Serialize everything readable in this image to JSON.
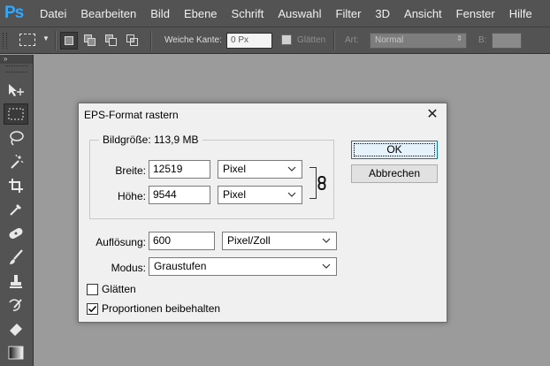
{
  "app": {
    "logo": "Ps"
  },
  "menubar": {
    "items": [
      "Datei",
      "Bearbeiten",
      "Bild",
      "Ebene",
      "Schrift",
      "Auswahl",
      "Filter",
      "3D",
      "Ansicht",
      "Fenster",
      "Hilfe"
    ]
  },
  "options_bar": {
    "feather_label": "Weiche Kante:",
    "feather_value": "0 Px",
    "antialias_label": "Glätten",
    "style_label": "Art:",
    "style_value": "Normal",
    "width_label": "B:"
  },
  "tools_panel": {
    "collapse_glyph": "»",
    "tools": [
      "move-tool-icon",
      "rectangular-marquee-icon",
      "lasso-icon",
      "magic-wand-icon",
      "crop-icon",
      "eyedropper-icon",
      "spot-healing-brush-icon",
      "brush-icon",
      "clone-stamp-icon",
      "history-brush-icon",
      "eraser-icon",
      "gradient-icon"
    ]
  },
  "dialog": {
    "title": "EPS-Format rastern",
    "close_glyph": "✕",
    "image_size_label": "Bildgröße: 113,9 MB",
    "width_label": "Breite:",
    "width_value": "12519",
    "width_unit": "Pixel",
    "height_label": "Höhe:",
    "height_value": "9544",
    "height_unit": "Pixel",
    "resolution_label": "Auflösung:",
    "resolution_value": "600",
    "resolution_unit": "Pixel/Zoll",
    "mode_label": "Modus:",
    "mode_value": "Graustufen",
    "antialias_label": "Glätten",
    "antialias_checked": false,
    "constrain_label": "Proportionen beibehalten",
    "constrain_checked": true,
    "ok_label": "OK",
    "cancel_label": "Abbrechen"
  },
  "colors": {
    "workspace": "#9b9b9b",
    "chrome": "#535353",
    "dialog_bg": "#f0f0f0",
    "ps_blue": "#31a8ff",
    "focus_blue": "#0078d7"
  }
}
